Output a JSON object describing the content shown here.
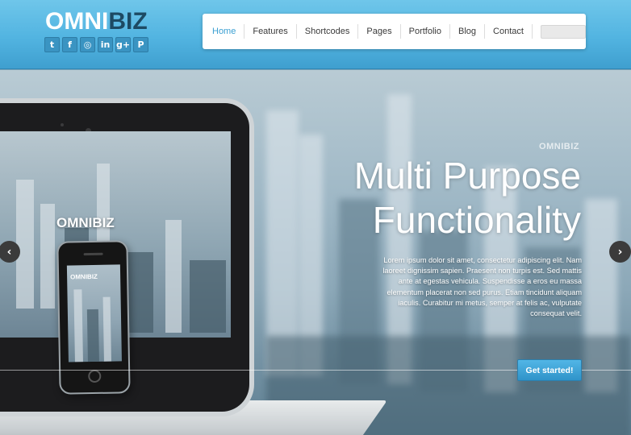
{
  "brand": {
    "part1": "OMNI",
    "part2": "BIZ"
  },
  "social": [
    {
      "name": "twitter-icon",
      "glyph": "t"
    },
    {
      "name": "facebook-icon",
      "glyph": "f"
    },
    {
      "name": "dribbble-icon",
      "glyph": "◎"
    },
    {
      "name": "linkedin-icon",
      "glyph": "in"
    },
    {
      "name": "googleplus-icon",
      "glyph": "g+"
    },
    {
      "name": "pinterest-icon",
      "glyph": "P"
    }
  ],
  "nav": {
    "items": [
      "Home",
      "Features",
      "Shortcodes",
      "Pages",
      "Portfolio",
      "Blog",
      "Contact"
    ],
    "active": "Home",
    "search_placeholder": ""
  },
  "hero": {
    "brand": "OMNIBIZ",
    "title_line1": "Multi Purpose",
    "title_line2": "Functionality",
    "description": "Lorem ipsum dolor sit amet, consectetur adipiscing elit. Nam laoreet dignissim sapien. Praesent non turpis est. Sed mattis ante at egestas vehicula. Suspendisse a eros eu massa elementum placerat non sed purus. Etiam tincidunt aliquam iaculis. Curabitur mi metus, semper at felis ac, vulputate consequat velit.",
    "cta_label": "Get started!",
    "laptop_logo": "OMNIBIZ",
    "phone_logo": "OMNIBIZ",
    "prev_glyph": "‹",
    "next_glyph": "›"
  },
  "colors": {
    "accent": "#3a9fd2",
    "header_top": "#6fc6ea",
    "header_bottom": "#3f9fcf",
    "cta": "#2f93c9"
  }
}
